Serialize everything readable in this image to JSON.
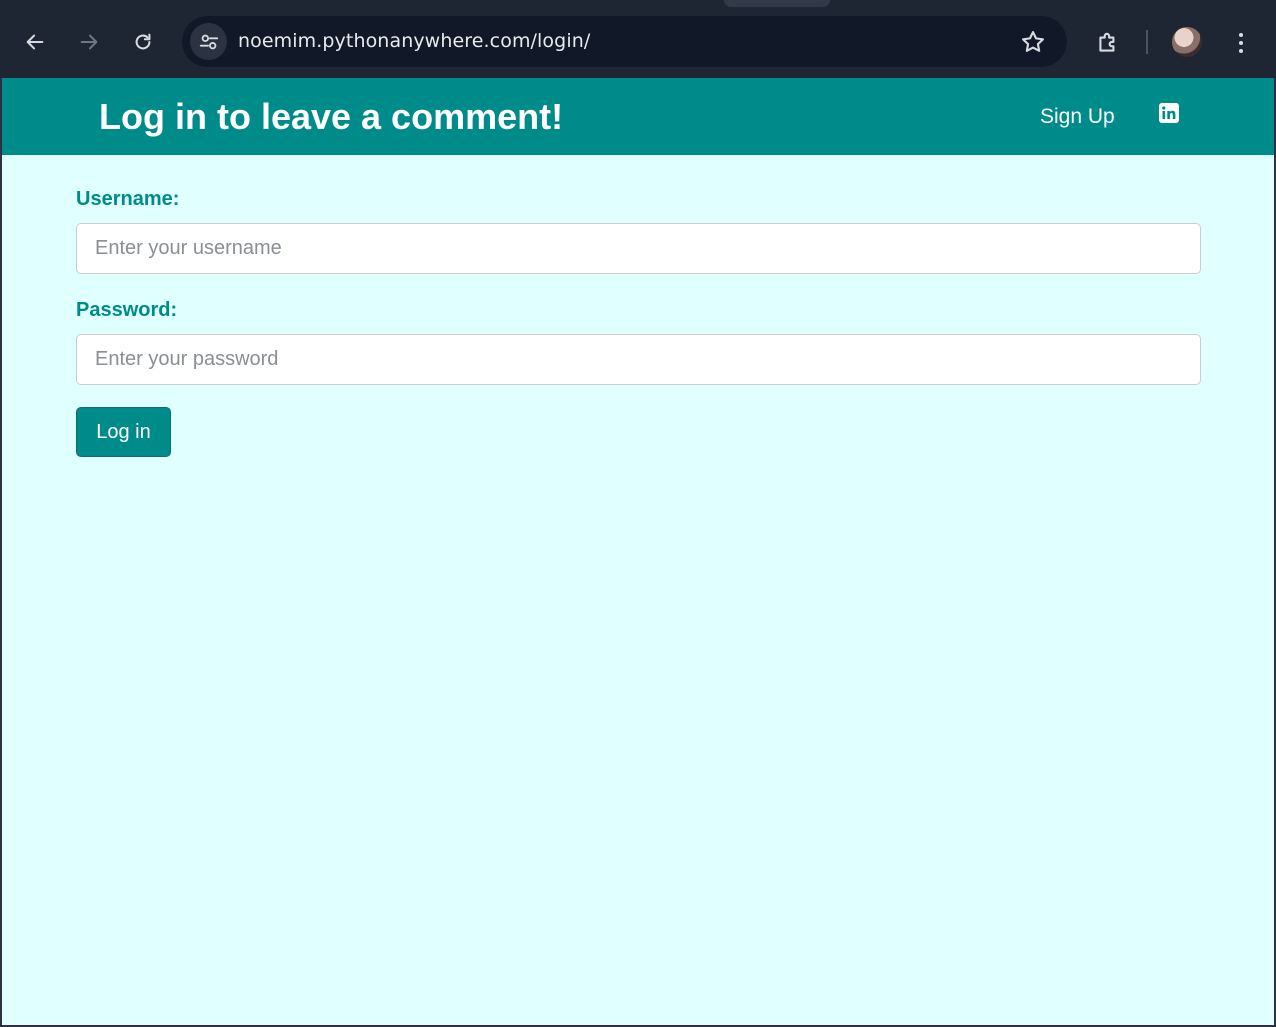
{
  "browser": {
    "url": "noemim.pythonanywhere.com/login/",
    "icons": {
      "back": "back-arrow-icon",
      "forward": "forward-arrow-icon",
      "reload": "reload-icon",
      "site_info": "tune-icon",
      "bookmark": "star-icon",
      "extensions": "puzzle-icon",
      "profile": "avatar",
      "menu": "kebab-menu-icon"
    }
  },
  "header": {
    "title": "Log in to leave a comment!",
    "signup_label": "Sign Up",
    "social_icon": "linkedin-icon"
  },
  "form": {
    "username_label": "Username:",
    "username_placeholder": "Enter your username",
    "password_label": "Password:",
    "password_placeholder": "Enter your password",
    "submit_label": "Log in"
  },
  "colors": {
    "header_bg": "#008b8b",
    "page_bg": "#e0ffff",
    "label": "#008b8b",
    "button_bg": "#008b8b",
    "chrome_bg": "#1f2633"
  }
}
